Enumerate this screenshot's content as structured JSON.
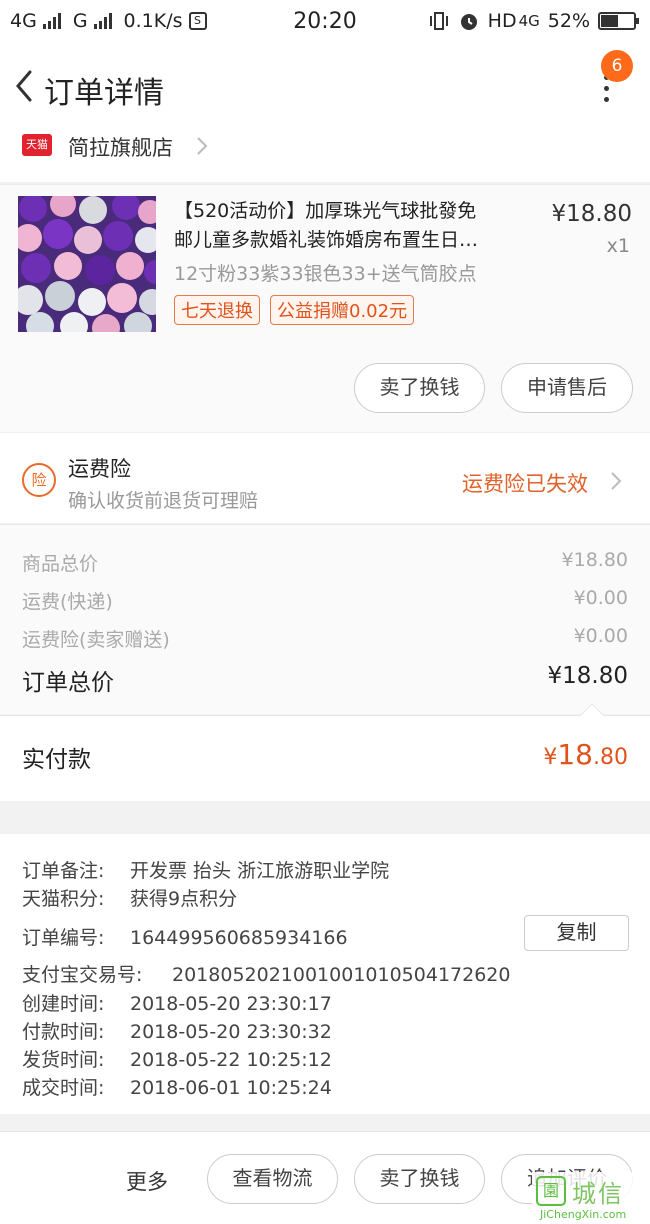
{
  "status_bar": {
    "network1": "4G",
    "network2": "G",
    "speed": "0.1K/s",
    "s_icon": "S",
    "time": "20:20",
    "hd": "HD",
    "net4g": "4G",
    "battery": "52%",
    "battery_level": 0.52
  },
  "header": {
    "title": "订单详情",
    "badge_count": "6"
  },
  "shop": {
    "logo": "天猫",
    "name": "简拉旗舰店"
  },
  "product": {
    "title_line1": "【520活动价】加厚珠光气球批發免",
    "title_line2": "邮儿童多款婚礼装饰婚房布置生日…",
    "price": "¥18.80",
    "quantity": "x1",
    "sku": "12寸粉33紫33银色33+送气筒胶点",
    "tags": [
      "七天退换",
      "公益捐赠0.02元"
    ],
    "buttons": {
      "sell": "卖了换钱",
      "after_sale": "申请售后"
    }
  },
  "insurance": {
    "icon_text": "险",
    "title": "运费险",
    "subtitle": "确认收货前退货可理赔",
    "status": "运费险已失效"
  },
  "costs": {
    "rows": [
      {
        "label": "商品总价",
        "value": "¥18.80"
      },
      {
        "label": "运费(快递)",
        "value": "¥0.00"
      },
      {
        "label": "运费险(卖家赠送)",
        "value": "¥0.00"
      }
    ],
    "total_label": "订单总价",
    "total_value": "¥18.80"
  },
  "paid": {
    "label": "实付款",
    "currency": "¥",
    "integer": "18",
    "decimal": ".80"
  },
  "order_info": {
    "lines": [
      {
        "label": "订单备注:",
        "value": "开发票 抬头 浙江旅游职业学院"
      },
      {
        "label": "天猫积分:",
        "value": "获得9点积分"
      },
      {
        "label": "订单编号:",
        "value": "164499560685934166"
      },
      {
        "label": "支付宝交易号:",
        "value": "2018052021001001010504172620"
      },
      {
        "label": "创建时间:",
        "value": "2018-05-20 23:30:17"
      },
      {
        "label": "付款时间:",
        "value": "2018-05-20 23:30:32"
      },
      {
        "label": "发货时间:",
        "value": "2018-05-22 10:25:12"
      },
      {
        "label": "成交时间:",
        "value": "2018-06-01 10:25:24"
      }
    ],
    "copy_label": "复制"
  },
  "bottom_bar": {
    "more": "更多",
    "logistics": "查看物流",
    "sell": "卖了换钱",
    "review": "追加评价"
  },
  "watermark": {
    "logo": "園",
    "cn": "城信",
    "en": "JiChengXin.com"
  },
  "colors": {
    "accent": "#e0531d",
    "badge": "#ff6a1a",
    "tmall_red": "#e0232f"
  }
}
